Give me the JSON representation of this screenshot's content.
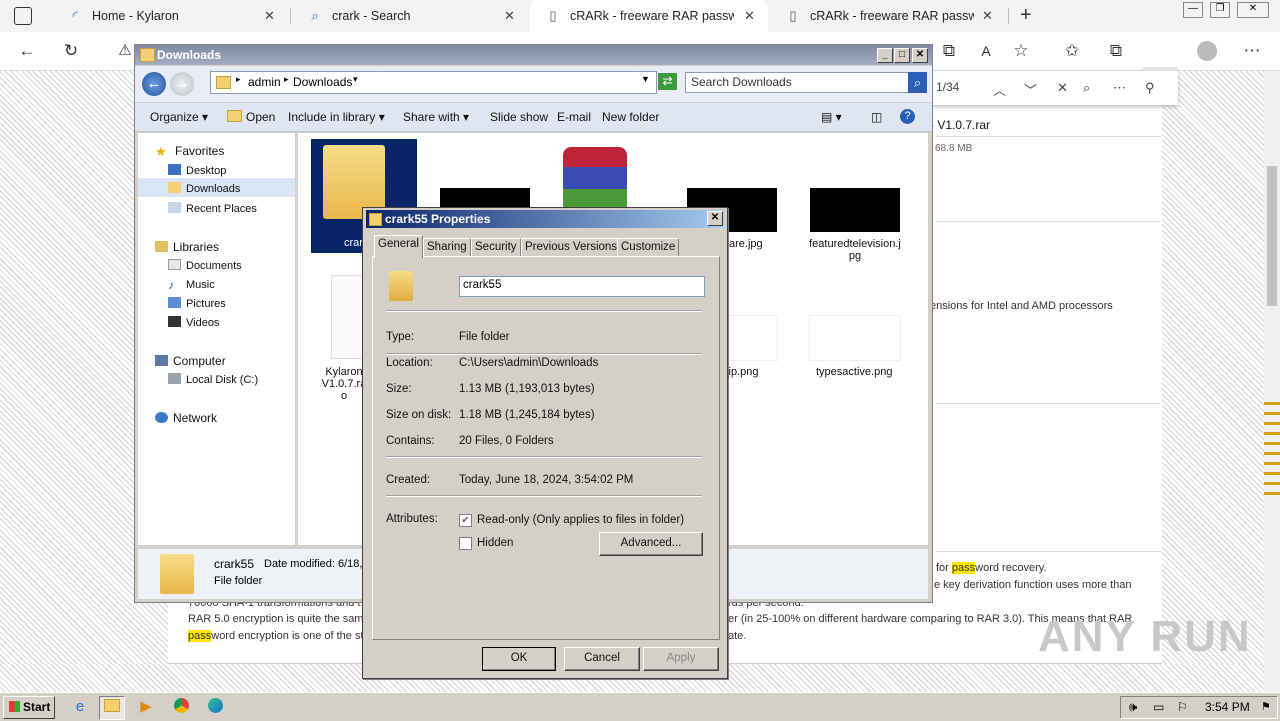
{
  "browser": {
    "tabs": [
      {
        "title": "Home - Kylaron",
        "icon": "loading-icon"
      },
      {
        "title": "crark - Search",
        "icon": "search-icon"
      },
      {
        "title": "cRARk - freeware RAR passworc",
        "icon": "page-icon"
      },
      {
        "title": "cRARk - freeware RAR passworc",
        "icon": "page-icon"
      }
    ],
    "find": {
      "count": "1/34"
    },
    "page": {
      "file_title": "- V1.0.7.rar",
      "file_size": "68.8 MB",
      "line_processors": "ensions for Intel and AMD processors",
      "line1_pre": "for ",
      "line1_hl": "pass",
      "line1_post": "word recovery.",
      "line2": "e key derivation function uses more than",
      "line3": "70000 SHA-1 transformations and t",
      "line3b": "rds per second.",
      "line4": "RAR 5.0 encryption is quite the sam",
      "line4b": "er (in 25-100% on different hardware comparing to RAR 3.0). This means that RAR",
      "line5_hl": "pass",
      "line5": "word encryption is one of the st",
      "line5b": "ate."
    },
    "watermark": "ANY RUN"
  },
  "explorer": {
    "title": "Downloads",
    "breadcrumb": [
      "admin",
      "Downloads"
    ],
    "search_placeholder": "Search Downloads",
    "commands": [
      "Organize",
      "Open",
      "Include in library",
      "Share with",
      "Slide show",
      "E-mail",
      "New folder"
    ],
    "nav": {
      "favorites": "Favorites",
      "desktop": "Desktop",
      "downloads": "Downloads",
      "recent": "Recent Places",
      "libraries": "Libraries",
      "documents": "Documents",
      "music": "Music",
      "pictures": "Pictures",
      "videos": "Videos",
      "computer": "Computer",
      "local_disk": "Local Disk (C:)",
      "network": "Network"
    },
    "files": {
      "folder_partial": "crar",
      "rar_partial1": "Kylaron",
      "rar_partial2": "V1.0.7.ra",
      "rar_partial3": "o",
      "care": "ycare.jpg",
      "featured1": "featuredtelevision.j",
      "featured2": "pg",
      "vip": "vip.png",
      "types": "typesactive.png"
    },
    "details": {
      "name": "crark55",
      "modified": "Date modified: 6/18,",
      "type": "File folder"
    }
  },
  "dialog": {
    "title": "crark55 Properties",
    "tabs": [
      "General",
      "Sharing",
      "Security",
      "Previous Versions",
      "Customize"
    ],
    "name_value": "crark55",
    "rows": {
      "type_label": "Type:",
      "type_value": "File folder",
      "location_label": "Location:",
      "location_value": "C:\\Users\\admin\\Downloads",
      "size_label": "Size:",
      "size_value": "1.13 MB (1,193,013 bytes)",
      "sizeondisk_label": "Size on disk:",
      "sizeondisk_value": "1.18 MB (1,245,184 bytes)",
      "contains_label": "Contains:",
      "contains_value": "20 Files, 0 Folders",
      "created_label": "Created:",
      "created_value": "Today, June 18, 2024, 3:54:02 PM",
      "attributes_label": "Attributes:"
    },
    "readonly_label": "Read-only (Only applies to files in folder)",
    "readonly_checked": true,
    "hidden_label": "Hidden",
    "hidden_checked": false,
    "advanced_label": "Advanced...",
    "ok_label": "OK",
    "cancel_label": "Cancel",
    "apply_label": "Apply"
  },
  "taskbar": {
    "start_label": "Start",
    "clock": "3:54 PM"
  }
}
